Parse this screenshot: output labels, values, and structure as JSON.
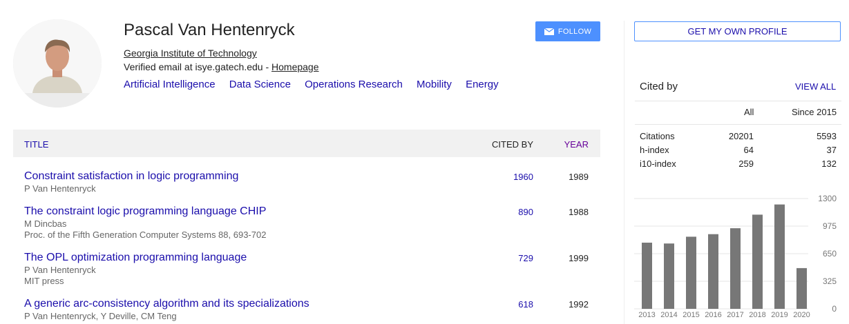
{
  "profile": {
    "name": "Pascal Van Hentenryck",
    "affiliation": "Georgia Institute of Technology",
    "email_text": "Verified email at isye.gatech.edu - ",
    "homepage_label": "Homepage",
    "interests": [
      "Artificial Intelligence",
      "Data Science",
      "Operations Research",
      "Mobility",
      "Energy"
    ],
    "follow_label": "FOLLOW"
  },
  "table": {
    "headers": {
      "title": "TITLE",
      "cited_by": "CITED BY",
      "year": "YEAR"
    },
    "rows": [
      {
        "title": "Constraint satisfaction in logic programming",
        "authors": "P Van Hentenryck",
        "venue": "",
        "cited_by": "1960",
        "year": "1989"
      },
      {
        "title": "The constraint logic programming language CHIP",
        "authors": "M Dincbas",
        "venue": "Proc. of the Fifth Generation Computer Systems 88, 693-702",
        "cited_by": "890",
        "year": "1988"
      },
      {
        "title": "The OPL optimization programming language",
        "authors": "P Van Hentenryck",
        "venue": "MIT press",
        "cited_by": "729",
        "year": "1999"
      },
      {
        "title": "A generic arc-consistency algorithm and its specializations",
        "authors": "P Van Hentenryck, Y Deville, CM Teng",
        "venue": "",
        "cited_by": "618",
        "year": "1992"
      }
    ]
  },
  "sidebar": {
    "own_profile_label": "GET MY OWN PROFILE",
    "cited_by_title": "Cited by",
    "view_all_label": "VIEW ALL",
    "col_all": "All",
    "col_since": "Since 2015",
    "stats": [
      {
        "label": "Citations",
        "all": "20201",
        "since": "5593"
      },
      {
        "label": "h-index",
        "all": "64",
        "since": "37"
      },
      {
        "label": "i10-index",
        "all": "259",
        "since": "132"
      }
    ]
  },
  "colors": {
    "link": "#1a0dab",
    "visited": "#660099",
    "button": "#4d90fe",
    "bar": "#777777"
  },
  "chart_data": {
    "type": "bar",
    "categories": [
      "2013",
      "2014",
      "2015",
      "2016",
      "2017",
      "2018",
      "2019",
      "2020"
    ],
    "values": [
      780,
      770,
      850,
      880,
      950,
      1110,
      1230,
      480
    ],
    "y_ticks": [
      "1300",
      "975",
      "650",
      "325",
      "0"
    ],
    "ylim": [
      0,
      1300
    ],
    "grid": true
  }
}
